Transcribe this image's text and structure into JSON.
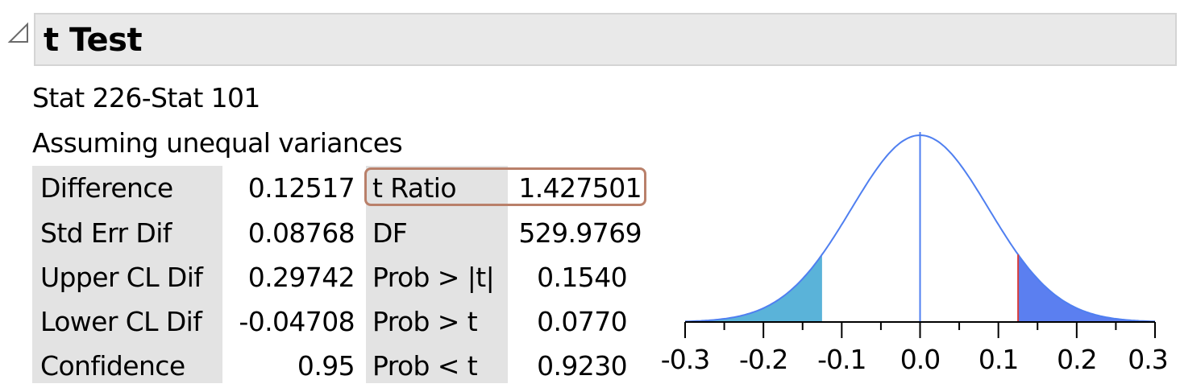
{
  "report": {
    "title": "t Test",
    "subtitle": "Stat 226-Stat 101",
    "assumption": "Assuming unequal variances"
  },
  "stats_left": [
    {
      "label": "Difference",
      "value": "0.12517"
    },
    {
      "label": "Std Err Dif",
      "value": "0.08768"
    },
    {
      "label": "Upper CL Dif",
      "value": "0.29742"
    },
    {
      "label": "Lower CL Dif",
      "value": "-0.04708"
    },
    {
      "label": "Confidence",
      "value": "0.95"
    }
  ],
  "stats_right": [
    {
      "label": "t Ratio",
      "value": "1.427501"
    },
    {
      "label": "DF",
      "value": "529.9769"
    },
    {
      "label": "Prob > |t|",
      "value": "0.1540"
    },
    {
      "label": "Prob > t",
      "value": "0.0770"
    },
    {
      "label": "Prob < t",
      "value": "0.9230"
    }
  ],
  "colors": {
    "curve": "#4f7ff0",
    "left_tail_fill": "#5ab3d9",
    "right_tail_fill": "#5b7ff0",
    "observed_line": "#d63c3c",
    "highlight_border": "#b9806a",
    "label_bg": "#e3e3e3"
  },
  "chart_data": {
    "type": "area",
    "xlim": [
      -0.3,
      0.3
    ],
    "x_ticks": [
      "-0.3",
      "-0.2",
      "-0.1",
      "0.0",
      "0.1",
      "0.2",
      "0.3"
    ],
    "distribution_sd": 0.08768,
    "observed_difference": 0.12517,
    "shaded_tails": [
      {
        "from": -0.3,
        "to": -0.12517
      },
      {
        "from": 0.12517,
        "to": 0.3
      }
    ],
    "center_line": 0.0,
    "grid": false
  }
}
